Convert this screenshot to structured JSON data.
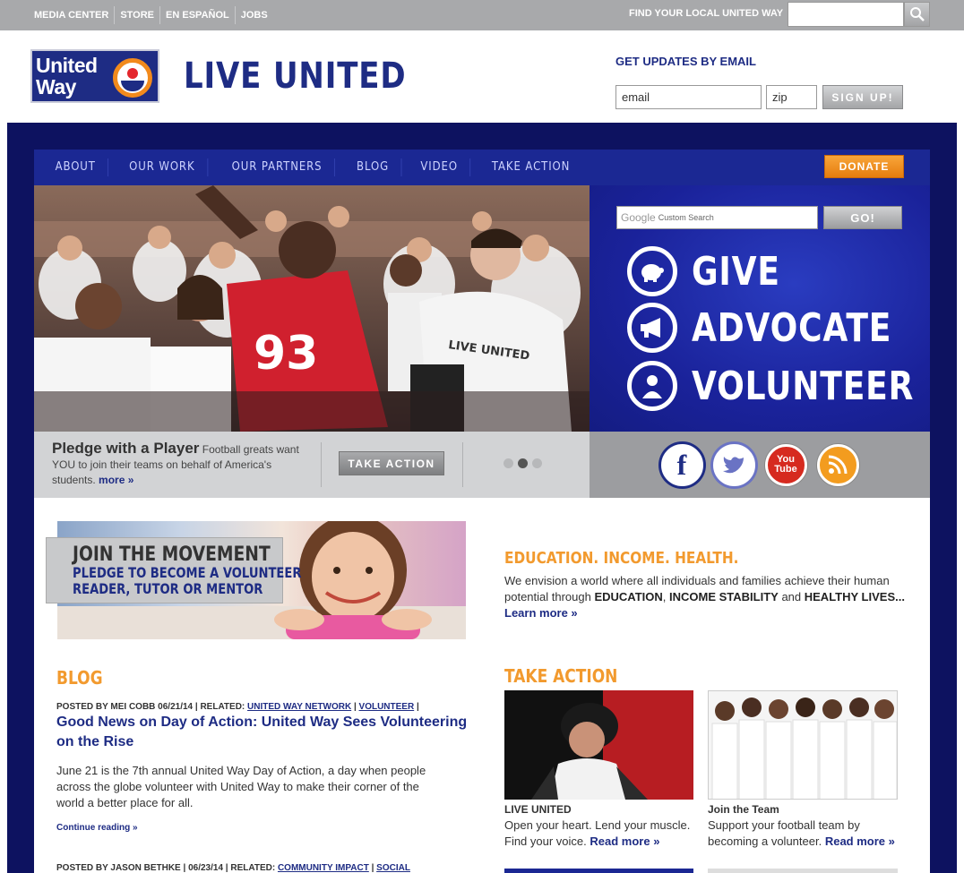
{
  "topbar": {
    "links": [
      "MEDIA CENTER",
      "STORE",
      "EN ESPAÑOL",
      "JOBS"
    ],
    "find_label": "FIND YOUR LOCAL UNITED WAY",
    "find_value": ""
  },
  "header": {
    "logo_line1": "United",
    "logo_line2": "Way",
    "tagline": "LIVE UNITED",
    "updates_title": "GET UPDATES BY EMAIL",
    "email_value": "email",
    "zip_value": "zip",
    "signup_label": "SIGN UP!"
  },
  "nav": {
    "items": [
      "ABOUT",
      "OUR WORK",
      "OUR PARTNERS",
      "BLOG",
      "VIDEO",
      "TAKE ACTION"
    ],
    "donate": "DONATE"
  },
  "hero": {
    "search_brand": "Google",
    "search_placeholder": "Custom Search",
    "go_label": "GO!",
    "actions": [
      "GIVE",
      "ADVOCATE",
      "VOLUNTEER"
    ],
    "jersey_number": "93",
    "shirt_text": "LIVE UNITED"
  },
  "pledge": {
    "title": "Pledge with a Player",
    "body": "Football greats want YOU to join their teams on behalf of America's students.",
    "more": "more »",
    "button": "TAKE ACTION",
    "slides": 3,
    "active_slide": 2
  },
  "social": [
    "facebook",
    "twitter",
    "youtube",
    "rss"
  ],
  "join": {
    "title": "JOIN THE MOVEMENT",
    "line1": "PLEDGE TO BECOME A VOLUNTEER",
    "line2": "READER, TUTOR OR MENTOR"
  },
  "eih": {
    "title": "EDUCATION. INCOME. HEALTH.",
    "body_pre": "We envision a world where all individuals and families achieve their human potential through ",
    "b1": "EDUCATION",
    "sep1": ", ",
    "b2": "INCOME STABILITY",
    "sep2": " and ",
    "b3": "HEALTHY LIVES...",
    "learn_more": "Learn more »"
  },
  "blog": {
    "title": "BLOG",
    "post1_meta": "POSTED BY MEI COBB 06/21/14 | RELATED: ",
    "post1_tag1": "UNITED WAY NETWORK",
    "post1_tag2": "VOLUNTEER",
    "post1_title": "Good News on Day of Action: United Way Sees Volunteering on the Rise",
    "post1_body": "June 21 is the 7th annual United Way Day of Action, a day when people across the globe volunteer with United Way to make their corner of the world a better place for all.",
    "continue": "Continue reading »",
    "post2_meta": "POSTED BY JASON BETHKE | 06/23/14 | RELATED: ",
    "post2_tag1": "COMMUNITY IMPACT",
    "post2_tag2": "SOCIAL"
  },
  "take_action": {
    "title": "TAKE ACTION",
    "items": [
      {
        "caption": "LIVE UNITED",
        "body": "Open your heart. Lend your muscle. Find your voice.",
        "more": "Read more »"
      },
      {
        "caption": "Join the Team",
        "body": "Support your football team by becoming a volunteer.",
        "more": "Read more »"
      }
    ]
  },
  "colors": {
    "navy": "#1e2c84",
    "orange": "#f29a2e",
    "frame": "#0d1260",
    "gray": "#a8a9ab"
  }
}
